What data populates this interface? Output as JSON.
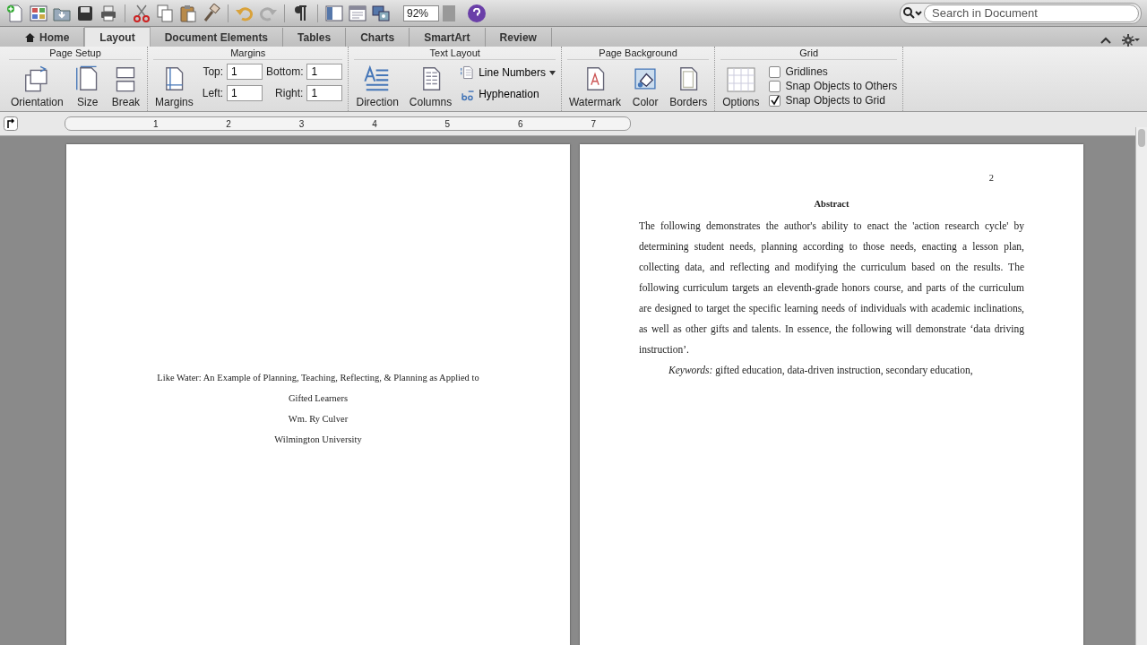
{
  "toolbar": {
    "zoom": "92%",
    "search": {
      "placeholder": "Search in Document"
    }
  },
  "tabs": [
    {
      "label": "Home",
      "kind": "home",
      "selected": false
    },
    {
      "label": "Layout",
      "kind": "plain",
      "selected": true
    },
    {
      "label": "Document Elements",
      "kind": "plain",
      "selected": false
    },
    {
      "label": "Tables",
      "kind": "plain",
      "selected": false
    },
    {
      "label": "Charts",
      "kind": "plain",
      "selected": false
    },
    {
      "label": "SmartArt",
      "kind": "plain",
      "selected": false
    },
    {
      "label": "Review",
      "kind": "plain",
      "selected": false
    }
  ],
  "ribbon": {
    "page_setup": {
      "title": "Page Setup",
      "buttons": [
        "Orientation",
        "Size",
        "Break"
      ]
    },
    "margins": {
      "title": "Margins",
      "button": "Margins",
      "fields": [
        {
          "label": "Top:",
          "value": "1"
        },
        {
          "label": "Bottom:",
          "value": "1"
        },
        {
          "label": "Left:",
          "value": "1"
        },
        {
          "label": "Right:",
          "value": "1"
        }
      ]
    },
    "text_layout": {
      "title": "Text Layout",
      "buttons": [
        "Direction",
        "Columns"
      ],
      "line_numbers": "Line Numbers",
      "hyphenation": "Hyphenation"
    },
    "page_background": {
      "title": "Page Background",
      "buttons": [
        "Watermark",
        "Color",
        "Borders"
      ]
    },
    "grid": {
      "title": "Grid",
      "button": "Options",
      "checkboxes": [
        {
          "label": "Gridlines",
          "checked": false
        },
        {
          "label": "Snap Objects to Others",
          "checked": false
        },
        {
          "label": "Snap Objects to Grid",
          "checked": true
        }
      ]
    }
  },
  "ruler": {
    "numbers": [
      "1",
      "2",
      "3",
      "4",
      "5",
      "6",
      "7"
    ]
  },
  "pages": {
    "title_page": {
      "lines": [
        "Like Water: An Example of Planning, Teaching, Reflecting, & Planning as Applied to",
        "Gifted Learners",
        "Wm. Ry Culver",
        "Wilmington University"
      ]
    },
    "abstract_page": {
      "page_number": "2",
      "heading": "Abstract",
      "paragraph": "The following demonstrates the author's ability to enact the 'action research cycle' by determining student needs, planning according to those needs, enacting a lesson plan, collecting data, and reflecting and modifying the curriculum based on the results.   The following curriculum targets an eleventh-grade honors course, and parts of the curriculum are designed to target the specific learning needs of individuals with academic inclinations, as well as other gifts and talents. In essence, the following will demonstrate ‘data driving instruction’.",
      "keywords": "*Keywords:* gifted education, data-driven instruction, secondary education,"
    }
  }
}
